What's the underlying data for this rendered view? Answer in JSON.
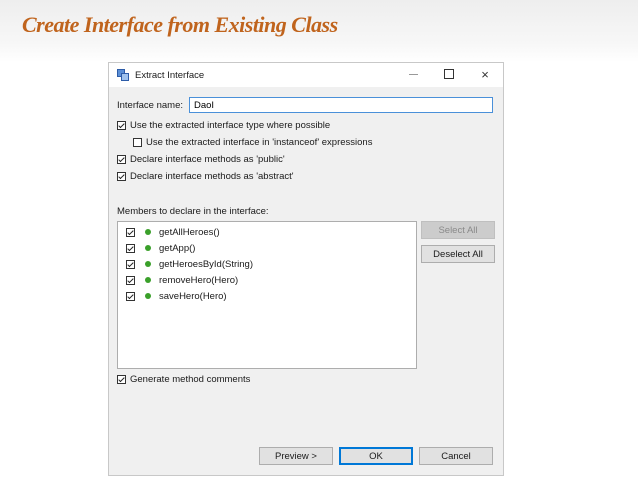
{
  "slide": {
    "title": "Create Interface from Existing Class"
  },
  "window": {
    "title": "Extract Interface",
    "icon": "extract-interface-icon",
    "controls": {
      "minimize": "minimize-icon",
      "maximize": "maximize-icon",
      "close": "×"
    }
  },
  "form": {
    "interface_name_label": "Interface name:",
    "interface_name_value": "DaoI",
    "options": [
      {
        "label": "Use the extracted interface type where possible",
        "checked": true
      },
      {
        "label": "Use the extracted interface in 'instanceof' expressions",
        "checked": false
      },
      {
        "label": "Declare interface methods as 'public'",
        "checked": true
      },
      {
        "label": "Declare interface methods as 'abstract'",
        "checked": true
      }
    ],
    "members_label": "Members to declare in the interface:",
    "members": [
      {
        "label": "getAllHeroes()",
        "checked": true
      },
      {
        "label": "getApp()",
        "checked": true
      },
      {
        "label": "getHeroesById(String)",
        "checked": true
      },
      {
        "label": "removeHero(Hero)",
        "checked": true
      },
      {
        "label": "saveHero(Hero)",
        "checked": true
      }
    ],
    "select_all_label": "Select All",
    "deselect_all_label": "Deselect All",
    "generate_comments": {
      "label": "Generate method comments",
      "checked": true
    }
  },
  "footer": {
    "preview_label": "Preview >",
    "ok_label": "OK",
    "cancel_label": "Cancel"
  },
  "colors": {
    "title": "#c0641d",
    "member_dot": "#3aa02a",
    "input_focus": "#4a90d9",
    "default_button": "#0078d7"
  }
}
